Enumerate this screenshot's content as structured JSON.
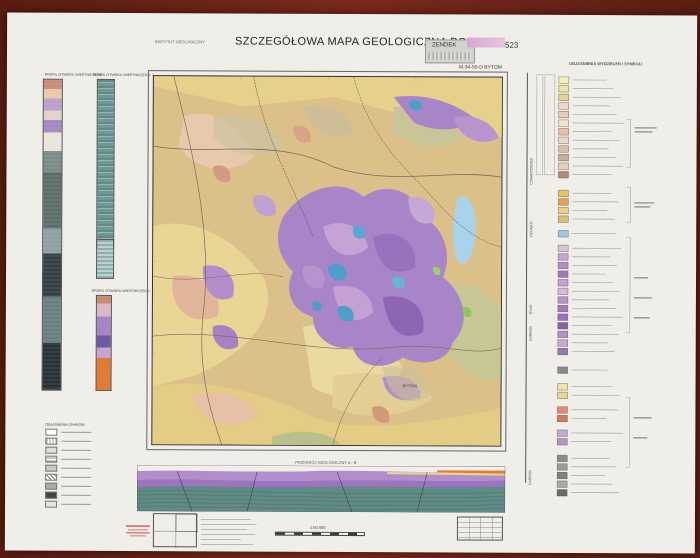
{
  "sheet": {
    "institute": "INSTYTUT GEOLOGICZNY",
    "title": "SZCZEGÓŁOWA MAPA GEOLOGICZNA POLSKI",
    "label_box": "ZENDEK",
    "sheet_number": "523",
    "sheet_code": "M-34-50-D BYTOM",
    "scale_text": "1:50 000",
    "city_on_map": "BYTOM"
  },
  "left_panel": {
    "column_a_title": "PROFIL OTWORU WIERTNICZEGO",
    "column_b_title": "PROFIL OTWORU WIERTNICZEGO",
    "column_c_title": "PROFIL OTWORU WIERTNICZEGO",
    "small_legend_title": "OBJAŚNIENIA ZNAKÓW"
  },
  "right_legend": {
    "title": "OBJAŚNIENIA WYDZIELEŃ I SYMBOLI",
    "groups": [
      {
        "label": "CZWARTORZĘD",
        "swatches": [
          "#f6f0b8",
          "#f0e2a0",
          "#e8d28a",
          "#f2d7c6",
          "#efc9b8",
          "#f7e6c4",
          "#e8c0a0",
          "#f0d8c0",
          "#d9c0a8",
          "#c8b098",
          "#e6d0b0",
          "#b08a70"
        ]
      },
      {
        "label": "NEOGEN",
        "swatches": [
          "#f0c050",
          "#e8a050",
          "#f3d080",
          "#d8c27a"
        ]
      },
      {
        "label": "JURA",
        "swatches": [
          "#9fc8e0"
        ]
      },
      {
        "label": "TRIAS",
        "swatches": [
          "#e0c0dc",
          "#c8a4d0",
          "#b48cc8",
          "#a378be",
          "#c6a2d4",
          "#d8b8dc",
          "#b890cc",
          "#a27cc0",
          "#9c70b8",
          "#8a62ac",
          "#b68ec6",
          "#c8a8d0",
          "#9878b8"
        ]
      },
      {
        "label": "KARBON",
        "swatches": [
          "#8a8a8a"
        ]
      },
      {
        "label": "CZWARTORZĘD",
        "swatches": [
          "#f0e6a8",
          "#e8d890"
        ]
      },
      {
        "label": "PERM",
        "swatches": [
          "#e48a6a",
          "#d47a62"
        ]
      },
      {
        "label": "TRIAS",
        "swatches": [
          "#c8a6d2",
          "#b794c8"
        ]
      },
      {
        "label": "KARBON",
        "swatches": [
          "#8c8c8c",
          "#9a9a9a",
          "#7e7e7e",
          "#a8a8a8",
          "#6a6a6a",
          "#b4b4b4",
          "#8a8a8a",
          "#9c9c9c",
          "#747474",
          "#a0a0a0"
        ]
      }
    ]
  },
  "profile": {
    "title": "PRZEKRÓJ GEOLOGICZNY A - B"
  },
  "colors": {
    "wall": "#6e2418",
    "sheet": "#efeee9",
    "map_base": "#dcc08a",
    "trias_violet": "#a884c8",
    "jura_blue": "#4f9ec8",
    "quaternary_yellow": "#e8d590",
    "lake_blue": "#a9d3ea"
  }
}
